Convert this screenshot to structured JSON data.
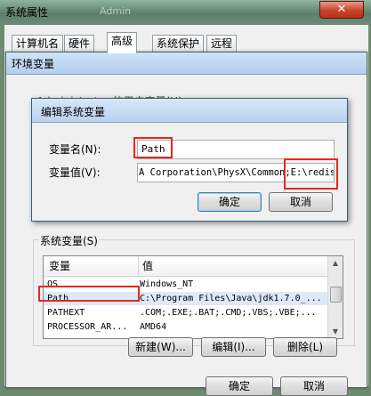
{
  "outer": {
    "title": "系统属性",
    "ghost_title": "Admin",
    "close_glyph": "✕",
    "tabs": [
      "计算机名",
      "硬件",
      "高级",
      "系统保护",
      "远程"
    ],
    "ok_label": "确定",
    "cancel_label": "取消"
  },
  "env": {
    "title": "环境变量",
    "user_vars_label": "Administrator 的用户变量(U)",
    "system_vars_label": "系统变量(S)",
    "columns": [
      "变量",
      "值"
    ],
    "rows": [
      {
        "name": "OS",
        "value": "Windows_NT"
      },
      {
        "name": "Path",
        "value": "C:\\Program Files\\Java\\jdk1.7.0_..."
      },
      {
        "name": "PATHEXT",
        "value": ".COM;.EXE;.BAT;.CMD;.VBS;.VBE;..."
      },
      {
        "name": "PROCESSOR_AR...",
        "value": "AMD64"
      }
    ],
    "new_label": "新建(W)...",
    "edit_label": "编辑(I)...",
    "delete_label": "删除(L)"
  },
  "edit_dialog": {
    "title": "编辑系统变量",
    "name_label": "变量名(N):",
    "value_label": "变量值(V):",
    "name_value": "Path",
    "value_value": "A Corporation\\PhysX\\Common;E:\\redis",
    "ok_label": "确定",
    "cancel_label": "取消"
  },
  "colors": {
    "highlight": "#e8281c",
    "selected_row": "#dde9f7"
  }
}
